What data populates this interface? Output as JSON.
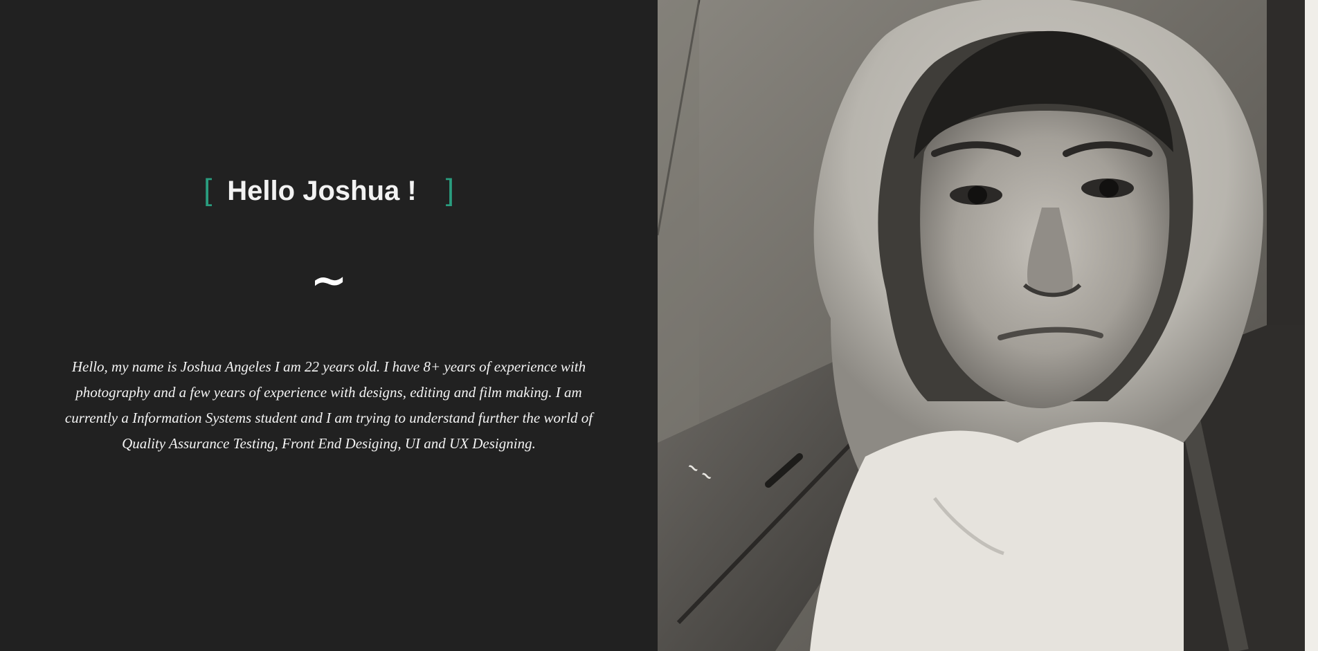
{
  "profile": {
    "greeting_bracket_open": "[",
    "greeting": "Hello  Joshua !",
    "greeting_bracket_close": "]",
    "divider_symbol": "~",
    "bio": "Hello, my name is Joshua Angeles I am 22 years old. I have 8+ years of experience with photography and a few years of experience with designs, editing and film making. I am currently a Information Systems student and I am trying to understand further the world of Quality Assurance Testing, Front End Desiging, UI and UX Designing."
  },
  "photo": {
    "subject": "black-and-white portrait of person in hooded sweatshirt"
  },
  "colors": {
    "panel_background": "#212121",
    "accent": "#2a9d7f",
    "text": "#f2f2f2"
  }
}
